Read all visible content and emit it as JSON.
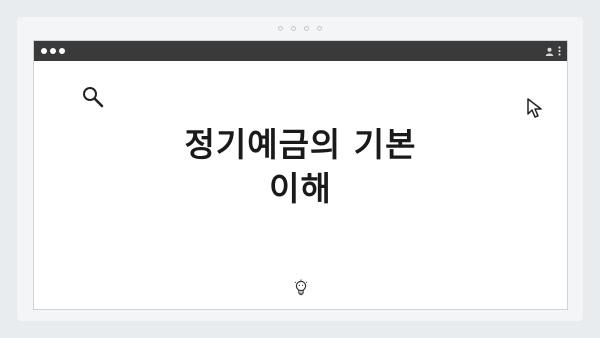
{
  "window": {
    "title_line1": "정기예금의 기본",
    "title_line2": "이해"
  },
  "icons": {
    "search": "search-icon",
    "cursor": "cursor-icon",
    "bulb": "lightbulb-icon",
    "profile": "profile-icon",
    "menu": "more-vertical-icon"
  },
  "colors": {
    "titlebar": "#3a3a3a",
    "background": "#e9ecef",
    "window_bg": "#ffffff",
    "title_text": "#1a1a1a"
  }
}
